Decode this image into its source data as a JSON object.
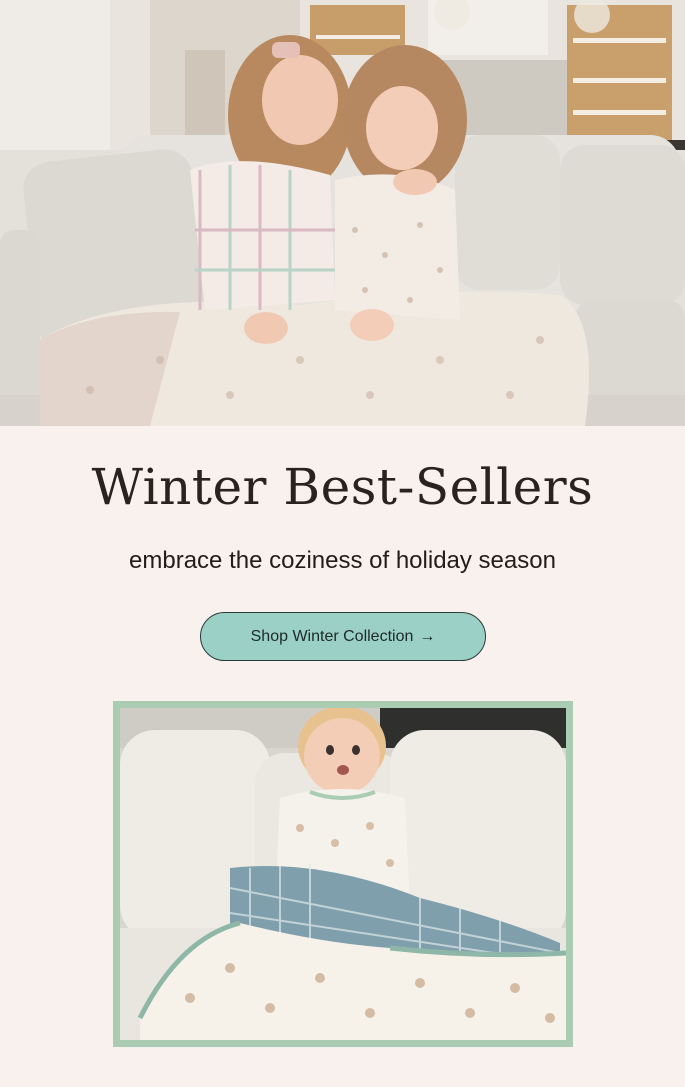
{
  "hero": {
    "image_alt": "Two girls in matching pajamas sitting on a cream sofa under a printed blanket"
  },
  "headline": "Winter Best-Sellers",
  "subhead": "embrace the coziness of holiday season",
  "cta": {
    "label": "Shop Winter Collection",
    "arrow": "→",
    "color": "#9bd0c6"
  },
  "feature": {
    "image_alt": "Baby in printed pajamas sitting on a white sofa with a plaid-trimmed blanket",
    "frame_color": "#a9ccb2"
  },
  "colors": {
    "background": "#f8f1ee",
    "text": "#2b2220"
  }
}
